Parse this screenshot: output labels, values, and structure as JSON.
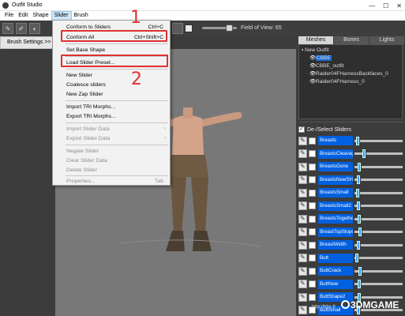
{
  "window": {
    "title": "Outfit Studio",
    "controls": [
      "—",
      "☐",
      "✕"
    ]
  },
  "menubar": [
    "File",
    "Edit",
    "Shape",
    "Slider",
    "Brush"
  ],
  "toolbar": {
    "fov_label": "Field of View: 65"
  },
  "brush_settings": {
    "header": "Brush Settings >>"
  },
  "right_panel": {
    "tabs": [
      "Meshes",
      "Bones",
      "Lights"
    ],
    "outfit_root": "New Outfit",
    "meshes": [
      "CBBE",
      "CBBE_outfit",
      "Raider04FHarnessBackfaces_0",
      "Raider04FHarness_0"
    ],
    "sliders_header": "De-/Select Sliders",
    "sliders": [
      "Breasts",
      "BreastsCleavage",
      "BreastsGone",
      "BreastsNewSH",
      "BreastsSmall",
      "BreastsSmall2",
      "BreastsTogether",
      "BreastTopSlope",
      "BreastWidth",
      "Butt",
      "ButtCrack",
      "ButtNew",
      "ButtShape2",
      "ButtSmall"
    ]
  },
  "slider_menu": {
    "conform_to_sliders": "Conform to Sliders",
    "conform_to_sliders_sc": "Ctrl+C",
    "conform_all": "Conform All",
    "conform_all_sc": "Ctrl+Shift+C",
    "set_base_shape": "Set Base Shape",
    "load_slider_preset": "Load Slider Preset...",
    "new_slider": "New Slider",
    "coalesce_sliders": "Coalesce sliders",
    "new_zap_slider": "New Zap Slider",
    "import_tri": "Import TRI Morphs...",
    "export_tri": "Export TRI Morphs...",
    "import_slider_data": "Import Slider Data",
    "export_slider_data": "Export Slider Data",
    "negate_slider": "Negate Slider",
    "clear_slider_data": "Clear Slider Data",
    "delete_slider": "Delete Slider",
    "properties": "Properties...",
    "properties_sc": "Tab"
  },
  "annotations": {
    "marker_1": "1",
    "marker_2": "2"
  },
  "watermark": {
    "url": "http://bbs.9",
    "logo": "3DMGAME"
  },
  "colors": {
    "highlight": "#e03030",
    "selected_slider": "#0060e0",
    "viewport": "#787878"
  }
}
